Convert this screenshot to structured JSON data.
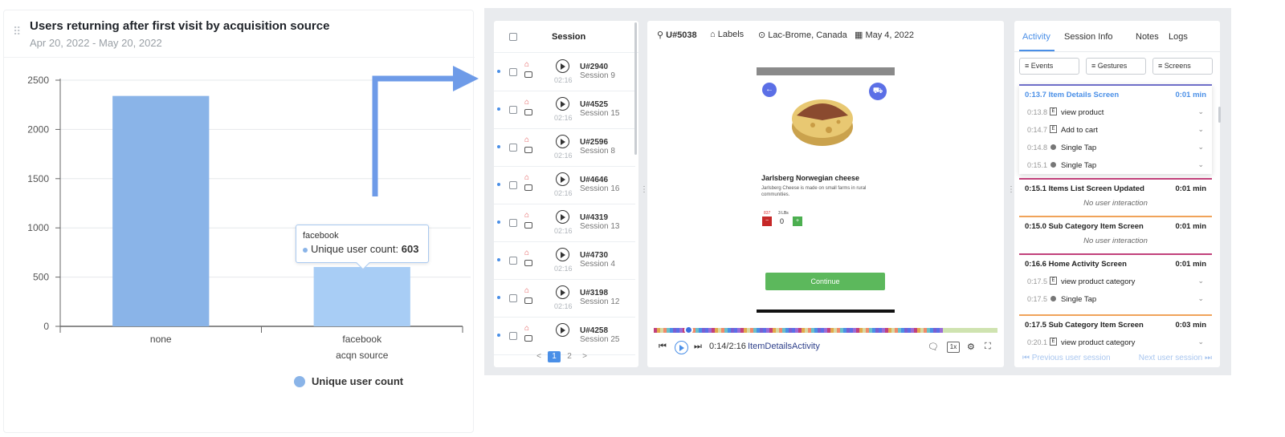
{
  "chart_card": {
    "title": "Users returning after first visit by acquisition source",
    "date_range": "Apr 20, 2022 - May 20, 2022",
    "tooltip": {
      "title": "facebook",
      "series": "Unique user count",
      "value": "603"
    },
    "legend_label": "Unique user count"
  },
  "chart_data": {
    "type": "bar",
    "categories": [
      "none",
      "facebook"
    ],
    "series": [
      {
        "name": "Unique user count",
        "values": [
          2340,
          603
        ]
      }
    ],
    "xlabel": "acqn source",
    "ylabel": "",
    "ylim": [
      0,
      2500
    ],
    "yticks": [
      0,
      500,
      1000,
      1500,
      2000,
      2500
    ],
    "colors": [
      "#8ab4e8",
      "#a8cdf5"
    ],
    "grid": true,
    "legend": "bottom-center"
  },
  "sessions": {
    "header_label": "Session",
    "rows": [
      {
        "uid": "U#2940",
        "session": "Session 9",
        "duration": "02:16"
      },
      {
        "uid": "U#4525",
        "session": "Session 15",
        "duration": "02:16"
      },
      {
        "uid": "U#2596",
        "session": "Session 8",
        "duration": "02:16"
      },
      {
        "uid": "U#4646",
        "session": "Session 16",
        "duration": "02:16"
      },
      {
        "uid": "U#4319",
        "session": "Session 13",
        "duration": "02:16"
      },
      {
        "uid": "U#4730",
        "session": "Session 4",
        "duration": "02:16"
      },
      {
        "uid": "U#3198",
        "session": "Session 12",
        "duration": "02:16"
      },
      {
        "uid": "U#4258",
        "session": "Session 25",
        "duration": ""
      }
    ],
    "pager": {
      "prev": "<",
      "pages": [
        "1",
        "2"
      ],
      "next": ">"
    }
  },
  "player": {
    "user": "U#5038",
    "labels": "Labels",
    "location": "Lac-Brome, Canada",
    "date": "May 4, 2022",
    "product_name": "Jarlsberg Norwegian cheese",
    "product_desc": "Jarlsberg Cheese is made on small farms in rural communities.",
    "stock_a": "837",
    "stock_b": "3 LBs",
    "quantity": "0",
    "continue_label": "Continue",
    "time": "0:14/2:16",
    "activity_name": "ItemDetailsActivity",
    "speed": "1x",
    "progress": 0.1
  },
  "activity": {
    "tabs": [
      "Activity",
      "Session Info",
      "Notes",
      "Logs"
    ],
    "filters": [
      "Events",
      "Gestures",
      "Screens"
    ],
    "groups": [
      {
        "time": "0:13.7",
        "title": "Item Details Screen",
        "duration": "0:01 min",
        "color": "#6f6fc8",
        "items": [
          {
            "time": "0:13.8",
            "label": "view product",
            "icon": "event"
          },
          {
            "time": "0:14.7",
            "label": "Add to cart",
            "icon": "event"
          },
          {
            "time": "0:14.8",
            "label": "Single Tap",
            "icon": "tap"
          },
          {
            "time": "0:15.1",
            "label": "Single Tap",
            "icon": "tap"
          }
        ]
      },
      {
        "time": "0:15.1",
        "title": "Items List Screen Updated",
        "duration": "0:01 min",
        "color": "#c2417b",
        "none": "No user interaction"
      },
      {
        "time": "0:15.0",
        "title": "Sub Category Item Screen",
        "duration": "0:01 min",
        "color": "#f0a35a",
        "none": "No user interaction"
      },
      {
        "time": "0:16.6",
        "title": "Home Activity Screen",
        "duration": "0:01 min",
        "color": "#c2417b",
        "items": [
          {
            "time": "0:17.5",
            "label": "view product category",
            "icon": "event"
          },
          {
            "time": "0:17.5",
            "label": "Single Tap",
            "icon": "tap"
          }
        ]
      },
      {
        "time": "0:17.5",
        "title": "Sub Category Item Screen",
        "duration": "0:03 min",
        "color": "#f0a35a",
        "items": [
          {
            "time": "0:20.1",
            "label": "view product category",
            "icon": "event"
          }
        ]
      }
    ],
    "prev_session": "Previous user session",
    "next_session": "Next user session"
  }
}
